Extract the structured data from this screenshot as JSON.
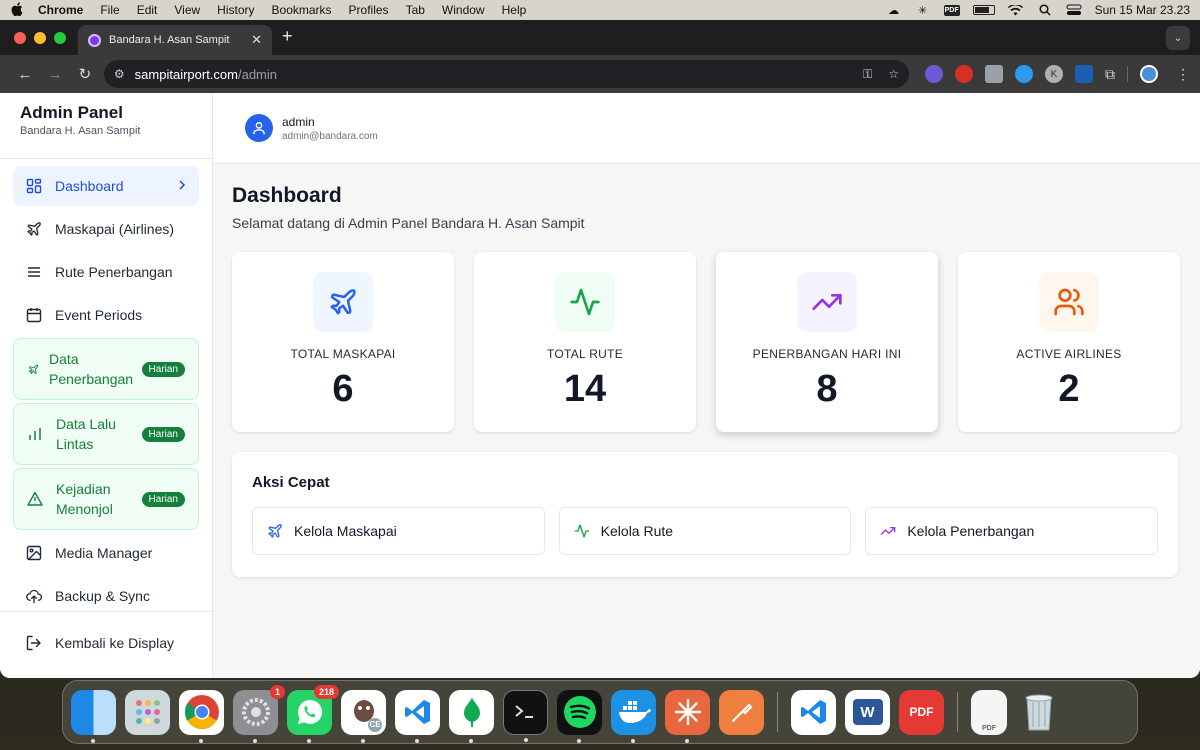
{
  "menubar": {
    "app": "Chrome",
    "items": [
      "File",
      "Edit",
      "View",
      "History",
      "Bookmarks",
      "Profiles",
      "Tab",
      "Window",
      "Help"
    ],
    "pdf_icon_label": "PDF",
    "clock": "Sun 15 Mar  23.23"
  },
  "browser": {
    "tab_title": "Bandara H. Asan Sampit",
    "url_host": "sampitairport.com",
    "url_path": "/admin",
    "extension_k_label": "K"
  },
  "sidebar": {
    "title": "Admin Panel",
    "subtitle": "Bandara H. Asan Sampit",
    "items": [
      {
        "label": "Dashboard"
      },
      {
        "label": "Maskapai (Airlines)"
      },
      {
        "label": "Rute Penerbangan"
      },
      {
        "label": "Event Periods"
      },
      {
        "label": "Data Penerbangan",
        "badge": "Harian"
      },
      {
        "label": "Data Lalu Lintas",
        "badge": "Harian"
      },
      {
        "label": "Kejadian Menonjol",
        "badge": "Harian"
      },
      {
        "label": "Media Manager"
      },
      {
        "label": "Backup & Sync"
      }
    ],
    "logout": "Kembali ke Display"
  },
  "user": {
    "name": "admin",
    "email": "admin@bandara.com"
  },
  "page": {
    "title": "Dashboard",
    "subtitle": "Selamat datang di Admin Panel Bandara H. Asan Sampit"
  },
  "stats": [
    {
      "label": "TOTAL MASKAPAI",
      "value": "6",
      "color": "#2563eb",
      "bg": "#eff6ff",
      "icon": "plane-icon"
    },
    {
      "label": "TOTAL RUTE",
      "value": "14",
      "color": "#16a34a",
      "bg": "#f0fdf4",
      "icon": "activity-icon"
    },
    {
      "label": "PENERBANGAN HARI INI",
      "value": "8",
      "color": "#9333ea",
      "bg": "#f5f3ff",
      "icon": "trending-up-icon"
    },
    {
      "label": "ACTIVE AIRLINES",
      "value": "2",
      "color": "#ea580c",
      "bg": "#fff7ed",
      "icon": "users-icon"
    }
  ],
  "quick": {
    "title": "Aksi Cepat",
    "actions": [
      {
        "label": "Kelola Maskapai",
        "icon": "plane-icon"
      },
      {
        "label": "Kelola Rute",
        "icon": "activity-icon"
      },
      {
        "label": "Kelola Penerbangan",
        "icon": "trending-up-icon"
      }
    ]
  },
  "dock": {
    "badges": {
      "settings": "1",
      "whatsapp": "218"
    },
    "labels": {
      "word": "W",
      "pdf": "PDF",
      "pdf_file": "PDF",
      "dbeaver": "CE"
    }
  }
}
